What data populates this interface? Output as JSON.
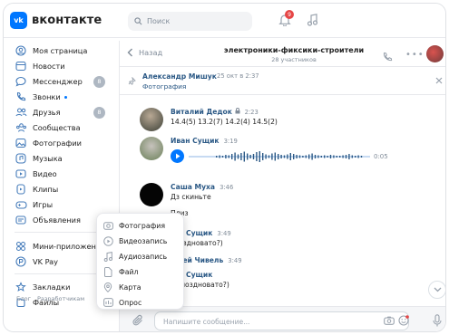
{
  "header": {
    "logo_mark": "vk",
    "logo_text": "вконтакте",
    "search_placeholder": "Поиск",
    "notification_count": "9"
  },
  "sidebar": {
    "items": [
      {
        "label": "Моя страница",
        "icon": "user-circle-icon"
      },
      {
        "label": "Новости",
        "icon": "news-icon"
      },
      {
        "label": "Мессенджер",
        "icon": "message-icon",
        "badge": "8"
      },
      {
        "label": "Звонки",
        "icon": "phone-icon",
        "dot": true
      },
      {
        "label": "Друзья",
        "icon": "friends-icon",
        "badge": "8"
      },
      {
        "label": "Сообщества",
        "icon": "communities-icon"
      },
      {
        "label": "Фотографии",
        "icon": "photo-icon"
      },
      {
        "label": "Музыка",
        "icon": "music-icon"
      },
      {
        "label": "Видео",
        "icon": "video-icon"
      },
      {
        "label": "Клипы",
        "icon": "clips-icon"
      },
      {
        "label": "Игры",
        "icon": "games-icon"
      },
      {
        "label": "Объявления",
        "icon": "ads-icon"
      },
      {
        "label": "Мини-приложения",
        "icon": "mini-apps-icon"
      },
      {
        "label": "VK Pay",
        "icon": "vkpay-icon"
      },
      {
        "label": "Закладки",
        "icon": "bookmark-icon"
      },
      {
        "label": "Файлы",
        "icon": "files-icon"
      }
    ],
    "footer": [
      "Блог",
      "Разработчикам"
    ]
  },
  "chat": {
    "back_label": "Назад",
    "title": "электроники-фиксики-строители",
    "subtitle": "28 участников",
    "pinned": {
      "author": "Александр Мишук",
      "date": "25 окт в 2:37",
      "text": "Фотография"
    },
    "messages": [
      {
        "name": "Виталий Дедок",
        "time": "2:23",
        "text": "14.4(5) 13.2(7) 14.2(4) 14.5(2)"
      },
      {
        "name": "Иван Сущик",
        "time": "3:19",
        "voice_duration": "0:05"
      },
      {
        "name": "Саша Муха",
        "time": "3:46",
        "lines": [
          "Дз скиньте",
          "Плиз"
        ]
      },
      {
        "name": "ан Сущик",
        "time": "3:49",
        "text": "поздновато?)"
      },
      {
        "name": "ргей Чивель",
        "time": "3:49"
      },
      {
        "name": "ан Сущик",
        "text": "е поздновато?)"
      }
    ],
    "composer_placeholder": "Напишите сообщение..."
  },
  "attach_menu": {
    "items": [
      {
        "label": "Фотография",
        "icon": "photo-icon"
      },
      {
        "label": "Видеозапись",
        "icon": "video-icon"
      },
      {
        "label": "Аудиозапись",
        "icon": "music-note-icon"
      },
      {
        "label": "Файл",
        "icon": "file-icon"
      },
      {
        "label": "Карта",
        "icon": "map-pin-icon"
      },
      {
        "label": "Опрос",
        "icon": "poll-icon"
      }
    ]
  },
  "colors": {
    "accent": "#0077ff",
    "link": "#2a5885",
    "muted": "#818c99",
    "badge": "#aeb7c2",
    "alert": "#e64646"
  }
}
